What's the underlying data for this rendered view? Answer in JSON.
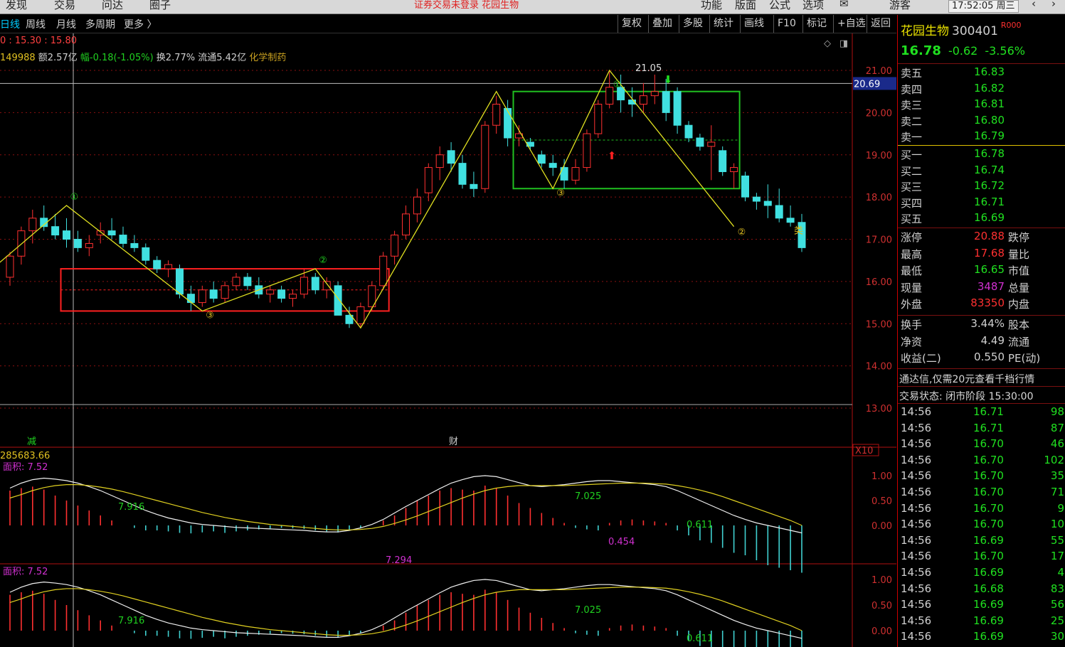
{
  "topbar": {
    "menu": [
      "发现",
      "交易",
      "问达",
      "圈子"
    ],
    "center": "证券交易未登录  花园生物",
    "right_menu": [
      "功能",
      "版面",
      "公式",
      "选项"
    ],
    "user": "游客",
    "clock": "17:52:05 周三"
  },
  "tabs": [
    "日线",
    "周线",
    "月线",
    "多周期",
    "更多 〉"
  ],
  "toolbar": [
    "复权",
    "叠加",
    "多股",
    "统计",
    "画线",
    "F10",
    "标记",
    "+自选",
    "返回"
  ],
  "info": {
    "line1": "0 : 15.30 : 15.80",
    "vol": "149988",
    "amount": "额2.57亿",
    "range": "幅-0.18(-1.05%)",
    "turnover": "换2.77%",
    "float": "流通5.42亿",
    "industry": "化学制药"
  },
  "stock": {
    "name": "花园生物",
    "code": "300401",
    "badge": "R000",
    "price": "16.78",
    "change": "-0.62",
    "pct": "-3.56%"
  },
  "asks": [
    {
      "label": "卖五",
      "price": "16.83"
    },
    {
      "label": "卖四",
      "price": "16.82"
    },
    {
      "label": "卖三",
      "price": "16.81"
    },
    {
      "label": "卖二",
      "price": "16.80"
    },
    {
      "label": "卖一",
      "price": "16.79"
    }
  ],
  "bids": [
    {
      "label": "买一",
      "price": "16.78"
    },
    {
      "label": "买二",
      "price": "16.74"
    },
    {
      "label": "买三",
      "price": "16.72"
    },
    {
      "label": "买四",
      "price": "16.71"
    },
    {
      "label": "买五",
      "price": "16.69"
    }
  ],
  "stats1": [
    {
      "label": "涨停",
      "value": "20.88",
      "label2": "跌停",
      "color": "#ff3030"
    },
    {
      "label": "最高",
      "value": "17.68",
      "label2": "量比",
      "color": "#ff3030"
    },
    {
      "label": "最低",
      "value": "16.65",
      "label2": "市值",
      "color": "#20e020"
    },
    {
      "label": "现量",
      "value": "3487",
      "label2": "总量",
      "color": "#d030d0"
    },
    {
      "label": "外盘",
      "value": "83350",
      "label2": "内盘",
      "color": "#ff3030"
    }
  ],
  "stats2": [
    {
      "label": "换手",
      "value": "3.44%",
      "label2": "股本",
      "color": "#d0d0d0"
    },
    {
      "label": "净资",
      "value": "4.49",
      "label2": "流通",
      "color": "#d0d0d0"
    },
    {
      "label": "收益(二)",
      "value": "0.550",
      "label2": "PE(动)",
      "color": "#d0d0d0"
    }
  ],
  "notice": "通达信,仅需20元查看千档行情",
  "status": "交易状态: 闭市阶段 15:30:00",
  "ticks": [
    {
      "t": "14:56",
      "p": "16.71",
      "v": "98"
    },
    {
      "t": "14:56",
      "p": "16.71",
      "v": "87"
    },
    {
      "t": "14:56",
      "p": "16.70",
      "v": "46"
    },
    {
      "t": "14:56",
      "p": "16.70",
      "v": "102"
    },
    {
      "t": "14:56",
      "p": "16.70",
      "v": "35"
    },
    {
      "t": "14:56",
      "p": "16.70",
      "v": "71"
    },
    {
      "t": "14:56",
      "p": "16.70",
      "v": "9"
    },
    {
      "t": "14:56",
      "p": "16.70",
      "v": "10"
    },
    {
      "t": "14:56",
      "p": "16.69",
      "v": "55"
    },
    {
      "t": "14:56",
      "p": "16.70",
      "v": "17"
    },
    {
      "t": "14:56",
      "p": "16.69",
      "v": "4"
    },
    {
      "t": "14:56",
      "p": "16.68",
      "v": "83"
    },
    {
      "t": "14:56",
      "p": "16.69",
      "v": "56"
    },
    {
      "t": "14:56",
      "p": "16.69",
      "v": "25"
    },
    {
      "t": "14:56",
      "p": "16.69",
      "v": "30"
    }
  ],
  "chart_data": {
    "type": "candlestick",
    "price_axis": [
      "21.00",
      "20.00",
      "19.00",
      "18.00",
      "17.00",
      "16.00",
      "15.00",
      "14.00",
      "13.00"
    ],
    "ylim": [
      13,
      21
    ],
    "cursor_price": "20.69",
    "high_label": "21.05",
    "macd_axis": [
      "1.00",
      "0.50",
      "0.00"
    ],
    "macd_labels": [
      "7.916",
      "7.025",
      "0.611",
      "0.454",
      "7.294"
    ],
    "area_label": "面积: 7.52",
    "vol_value": "285683.66",
    "x10": "X10",
    "marker_jian": "减",
    "marker_cai": "财",
    "pivot_labels": [
      "①",
      "②",
      "③",
      "③",
      "①",
      "②"
    ],
    "candles": [
      [
        16.1,
        16.7,
        15.9,
        16.6
      ],
      [
        16.6,
        17.3,
        16.4,
        17.2
      ],
      [
        17.2,
        17.7,
        16.9,
        17.5
      ],
      [
        17.5,
        17.8,
        17.2,
        17.3
      ],
      [
        17.3,
        17.6,
        17.0,
        17.1
      ],
      [
        17.2,
        17.5,
        16.8,
        17.0
      ],
      [
        17.0,
        17.2,
        16.7,
        16.8
      ],
      [
        16.8,
        17.1,
        16.6,
        16.9
      ],
      [
        17.1,
        17.4,
        16.9,
        17.2
      ],
      [
        17.2,
        17.5,
        17.0,
        17.1
      ],
      [
        17.1,
        17.3,
        16.8,
        16.9
      ],
      [
        16.9,
        17.1,
        16.7,
        16.8
      ],
      [
        16.8,
        16.9,
        16.4,
        16.5
      ],
      [
        16.5,
        16.6,
        16.2,
        16.3
      ],
      [
        16.3,
        16.5,
        16.1,
        16.4
      ],
      [
        16.3,
        16.4,
        15.6,
        15.7
      ],
      [
        15.7,
        15.9,
        15.3,
        15.5
      ],
      [
        15.5,
        15.9,
        15.4,
        15.8
      ],
      [
        15.8,
        16.0,
        15.5,
        15.6
      ],
      [
        15.6,
        16.0,
        15.5,
        15.9
      ],
      [
        15.9,
        16.2,
        15.8,
        16.1
      ],
      [
        16.1,
        16.2,
        15.8,
        15.9
      ],
      [
        15.9,
        16.1,
        15.6,
        15.7
      ],
      [
        15.7,
        15.9,
        15.5,
        15.8
      ],
      [
        15.8,
        15.9,
        15.5,
        15.6
      ],
      [
        15.6,
        15.8,
        15.4,
        15.7
      ],
      [
        15.7,
        16.3,
        15.6,
        16.1
      ],
      [
        16.1,
        16.2,
        15.7,
        15.8
      ],
      [
        15.8,
        16.1,
        15.6,
        16.0
      ],
      [
        15.9,
        16.0,
        15.3,
        15.2
      ],
      [
        15.2,
        15.4,
        14.9,
        15.0
      ],
      [
        15.0,
        15.5,
        14.9,
        15.4
      ],
      [
        15.4,
        16.0,
        15.3,
        15.9
      ],
      [
        15.9,
        16.7,
        15.8,
        16.6
      ],
      [
        16.6,
        17.2,
        16.4,
        17.1
      ],
      [
        17.1,
        17.8,
        17.0,
        17.6
      ],
      [
        17.6,
        18.2,
        17.4,
        18.0
      ],
      [
        18.1,
        18.8,
        17.9,
        18.7
      ],
      [
        18.7,
        19.2,
        18.4,
        19.0
      ],
      [
        19.1,
        19.3,
        18.6,
        18.8
      ],
      [
        18.8,
        19.0,
        18.2,
        18.3
      ],
      [
        18.3,
        18.6,
        18.0,
        18.2
      ],
      [
        18.2,
        19.8,
        18.1,
        19.7
      ],
      [
        19.7,
        20.4,
        19.5,
        20.2
      ],
      [
        20.1,
        20.3,
        19.2,
        19.4
      ],
      [
        19.4,
        19.7,
        19.2,
        19.5
      ],
      [
        19.3,
        19.4,
        19.1,
        19.2
      ],
      [
        19.0,
        19.1,
        18.7,
        18.8
      ],
      [
        18.8,
        19.0,
        18.5,
        18.7
      ],
      [
        18.7,
        18.9,
        18.2,
        18.4
      ],
      [
        18.4,
        18.9,
        18.3,
        18.7
      ],
      [
        18.7,
        19.6,
        18.6,
        19.5
      ],
      [
        19.5,
        20.3,
        19.4,
        20.2
      ],
      [
        20.2,
        21.0,
        20.1,
        20.6
      ],
      [
        20.6,
        20.9,
        20.0,
        20.3
      ],
      [
        20.3,
        20.6,
        19.9,
        20.2
      ],
      [
        20.2,
        20.7,
        20.0,
        20.4
      ],
      [
        20.4,
        20.9,
        20.2,
        20.5
      ],
      [
        20.5,
        20.8,
        19.8,
        20.0
      ],
      [
        20.5,
        20.6,
        19.5,
        19.7
      ],
      [
        19.7,
        19.8,
        19.3,
        19.4
      ],
      [
        19.4,
        19.5,
        19.1,
        19.2
      ],
      [
        19.2,
        19.7,
        18.4,
        19.3
      ],
      [
        19.1,
        19.2,
        18.5,
        18.6
      ],
      [
        18.6,
        18.8,
        18.2,
        18.7
      ],
      [
        18.5,
        18.6,
        17.9,
        18.0
      ],
      [
        18.0,
        18.1,
        17.7,
        17.9
      ],
      [
        17.9,
        18.3,
        17.5,
        17.8
      ],
      [
        17.8,
        18.2,
        17.4,
        17.5
      ],
      [
        17.5,
        17.8,
        17.3,
        17.4
      ],
      [
        17.4,
        17.6,
        16.7,
        16.8
      ]
    ],
    "zigzag": [
      [
        -2,
        16.2
      ],
      [
        5,
        17.8
      ],
      [
        17,
        15.3
      ],
      [
        27,
        16.3
      ],
      [
        31,
        14.9
      ],
      [
        43,
        20.5
      ],
      [
        48,
        18.2
      ],
      [
        53,
        21.0
      ],
      [
        64,
        17.3
      ]
    ],
    "boxes": [
      {
        "color": "#ff2020",
        "x0": 5,
        "x1": 33,
        "y0": 16.3,
        "y1": 15.3
      },
      {
        "color": "#20c020",
        "x0": 45,
        "x1": 64,
        "y0": 20.5,
        "y1": 18.2
      }
    ],
    "macd_hist": [
      0.7,
      0.75,
      0.78,
      0.72,
      0.6,
      0.5,
      0.4,
      0.3,
      0.2,
      0.1,
      0.0,
      -0.05,
      -0.1,
      -0.1,
      -0.12,
      -0.15,
      -0.16,
      -0.14,
      -0.12,
      -0.15,
      -0.12,
      -0.1,
      -0.08,
      -0.06,
      -0.05,
      -0.06,
      -0.07,
      -0.1,
      -0.12,
      -0.14,
      -0.1,
      -0.05,
      0.0,
      0.1,
      0.2,
      0.35,
      0.5,
      0.6,
      0.7,
      0.75,
      0.72,
      0.7,
      0.8,
      0.75,
      0.6,
      0.45,
      0.35,
      0.25,
      0.15,
      0.05,
      -0.05,
      -0.08,
      -0.1,
      0.05,
      0.1,
      0.12,
      0.1,
      0.08,
      0.05,
      -0.1,
      -0.2,
      -0.3,
      -0.35,
      -0.45,
      -0.55,
      -0.6,
      -0.7,
      -0.8,
      -0.85,
      -0.9,
      -0.95
    ],
    "dif": [
      0.75,
      0.85,
      0.92,
      0.95,
      0.93,
      0.9,
      0.85,
      0.78,
      0.7,
      0.6,
      0.5,
      0.4,
      0.3,
      0.22,
      0.15,
      0.1,
      0.05,
      0.02,
      0.0,
      -0.02,
      -0.04,
      -0.05,
      -0.06,
      -0.07,
      -0.08,
      -0.09,
      -0.1,
      -0.12,
      -0.13,
      -0.13,
      -0.1,
      -0.05,
      0.02,
      0.12,
      0.25,
      0.38,
      0.5,
      0.62,
      0.74,
      0.85,
      0.92,
      0.98,
      1.0,
      0.98,
      0.92,
      0.86,
      0.8,
      0.78,
      0.8,
      0.82,
      0.85,
      0.88,
      0.9,
      0.9,
      0.88,
      0.86,
      0.84,
      0.82,
      0.78,
      0.7,
      0.6,
      0.5,
      0.4,
      0.3,
      0.2,
      0.12,
      0.05,
      0.0,
      -0.05,
      -0.1,
      -0.15
    ],
    "dea": [
      0.55,
      0.62,
      0.7,
      0.76,
      0.8,
      0.82,
      0.82,
      0.8,
      0.77,
      0.73,
      0.68,
      0.62,
      0.56,
      0.5,
      0.44,
      0.38,
      0.32,
      0.26,
      0.21,
      0.16,
      0.12,
      0.08,
      0.05,
      0.02,
      0.0,
      -0.02,
      -0.04,
      -0.06,
      -0.08,
      -0.09,
      -0.09,
      -0.08,
      -0.06,
      -0.02,
      0.04,
      0.11,
      0.19,
      0.28,
      0.37,
      0.46,
      0.55,
      0.63,
      0.7,
      0.75,
      0.78,
      0.8,
      0.8,
      0.8,
      0.8,
      0.8,
      0.81,
      0.82,
      0.83,
      0.84,
      0.85,
      0.85,
      0.85,
      0.84,
      0.83,
      0.8,
      0.76,
      0.71,
      0.65,
      0.58,
      0.5,
      0.42,
      0.34,
      0.26,
      0.18,
      0.1,
      0.0
    ]
  }
}
